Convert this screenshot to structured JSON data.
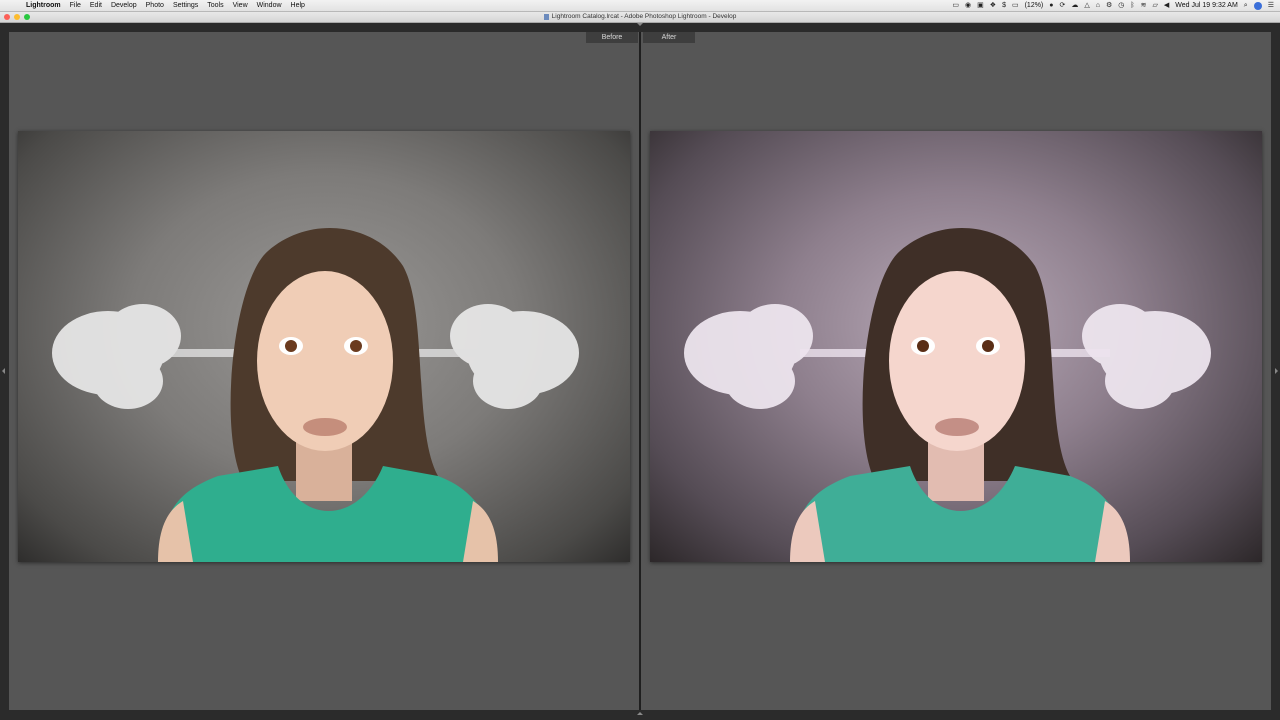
{
  "menubar": {
    "apple": "",
    "items": [
      "Lightroom",
      "File",
      "Edit",
      "Develop",
      "Photo",
      "Settings",
      "Tools",
      "View",
      "Window",
      "Help"
    ],
    "battery": "(12%)",
    "clock": "Wed Jul 19  9:32 AM"
  },
  "window": {
    "title": "Lightroom Catalog.lrcat - Adobe Photoshop Lightroom - Develop"
  },
  "compare": {
    "before_label": "Before",
    "after_label": "After"
  },
  "colors": {
    "before_shirt": "#2fae8e",
    "after_shirt": "#3fae97",
    "background_panel": "#565656"
  },
  "icons": [
    "apple-icon",
    "camera-icon",
    "dropbox-icon",
    "wifi-icon",
    "bluetooth-icon",
    "volume-icon",
    "search-icon",
    "notification-icon"
  ]
}
